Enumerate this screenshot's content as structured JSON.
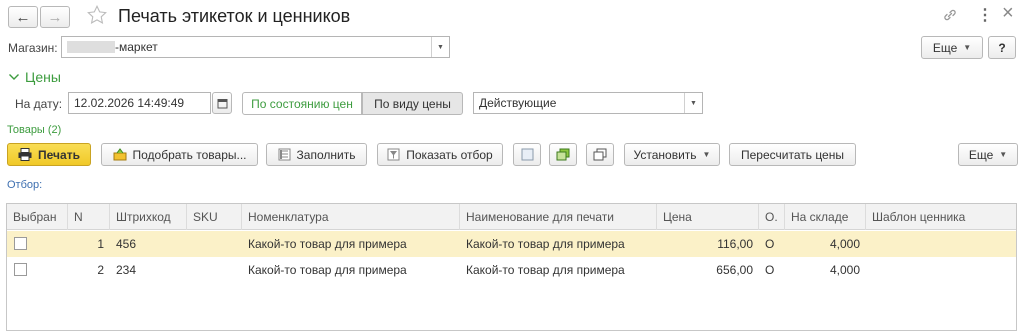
{
  "window": {
    "title": "Печать этикеток и ценников",
    "nav_back": "←",
    "nav_forward": "→",
    "more_glyph": "⋮",
    "close_glyph": "×"
  },
  "store": {
    "label": "Магазин:",
    "value": "-маркет",
    "more_button": "Еще",
    "help_button": "?"
  },
  "prices": {
    "section_title": "Цены",
    "date_label": "На дату:",
    "date_value": "12.02.2026 14:49:49",
    "toggle_state": "По состоянию цен",
    "toggle_type": "По виду цены",
    "price_kind": "Действующие"
  },
  "goods": {
    "section_title": "Товары (2)",
    "print_button": "Печать",
    "pick_button": "Подобрать товары...",
    "fill_button": "Заполнить",
    "filter_button": "Показать отбор",
    "set_button": "Установить",
    "recalc_button": "Пересчитать цены",
    "more_button": "Еще",
    "filter_label": "Отбор:"
  },
  "table": {
    "columns": [
      "Выбран",
      "N",
      "Штрихкод",
      "SKU",
      "Номенклатура",
      "Наименование для печати",
      "Цена",
      "О.",
      "На складе",
      "Шаблон ценника"
    ],
    "rows": [
      {
        "checked": false,
        "n": "1",
        "barcode": "456",
        "sku": "",
        "item": "Какой-то товар для примера",
        "print_name": "Какой-то товар для примера",
        "price": "116,00",
        "o": "О",
        "stock": "4,000",
        "template": ""
      },
      {
        "checked": false,
        "n": "2",
        "barcode": "234",
        "sku": "",
        "item": "Какой-то товар для примера",
        "print_name": "Какой-то товар для примера",
        "price": "656,00",
        "o": "О",
        "stock": "4,000",
        "template": ""
      }
    ]
  },
  "colors": {
    "accent_green": "#3d9c3f",
    "print_button_yellow": "#f5d33a",
    "selected_row": "#fbf1c8"
  }
}
